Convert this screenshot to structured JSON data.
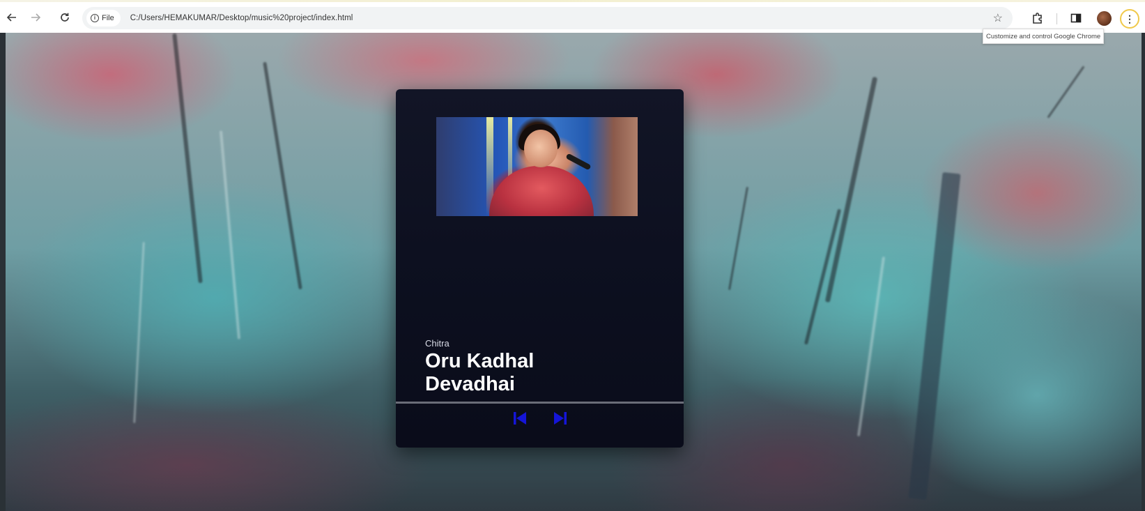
{
  "browser": {
    "chip_label": "File",
    "url": "C:/Users/HEMAKUMAR/Desktop/music%20project/index.html",
    "tooltip": "Customize and control Google Chrome",
    "icons": {
      "back": "arrow-left-icon",
      "forward": "arrow-right-icon",
      "reload": "reload-icon",
      "info": "info-icon",
      "bookmark": "star-icon",
      "extensions": "puzzle-icon",
      "side_panel": "side-panel-icon",
      "profile": "avatar-icon",
      "menu": "kebab-menu-icon"
    }
  },
  "player": {
    "artist": "Chitra",
    "title": "Oru Kadhal Devadhai",
    "controls": {
      "prev_icon": "skip-previous-icon",
      "next_icon": "skip-next-icon",
      "icon_color": "#1515d8"
    }
  },
  "colors": {
    "card_background": "#0d1020",
    "divider": "#6a6d78",
    "control_blue": "#1515d8"
  }
}
